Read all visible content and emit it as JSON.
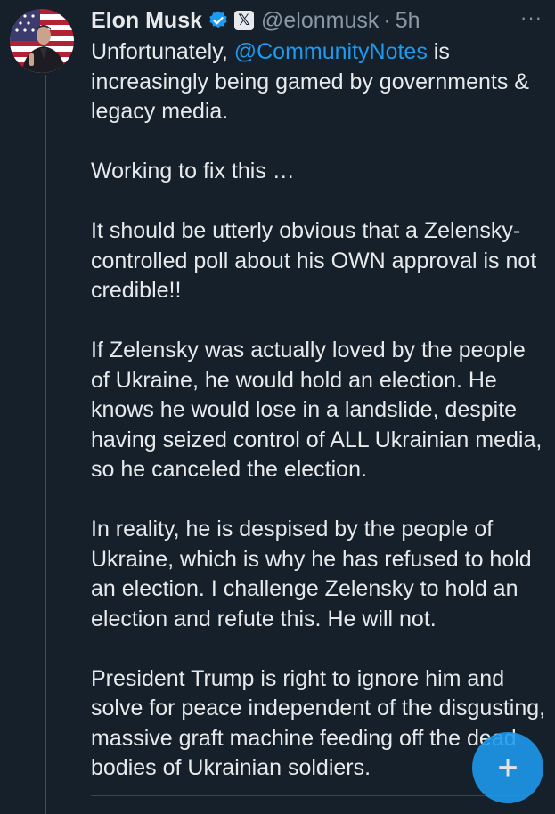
{
  "tweet": {
    "author_name": "Elon Musk",
    "handle": "@elonmusk",
    "separator": "·",
    "time": "5h",
    "x_badge": "𝕏",
    "more_glyph": "···",
    "mention": "@CommunityNotes",
    "paragraphs": [
      {
        "pre": "Unfortunately, ",
        "post": " is increasingly being gamed by governments & legacy media."
      },
      {
        "text": "Working to fix this …"
      },
      {
        "text": "It should be utterly obvious that a Zelensky-controlled poll about his OWN approval is not credible!!"
      },
      {
        "text": "If Zelensky was actually loved by the people of Ukraine, he would hold an election. He knows he would lose in a landslide, despite having seized control of ALL Ukrainian media, so he canceled the election."
      },
      {
        "text": "In reality, he is despised by the people of Ukraine, which is why he has refused to hold an election. I challenge Zelensky to hold an election and refute this. He will not."
      },
      {
        "text": "President Trump is right to ignore him and solve for peace independent of the disgusting, massive graft machine feeding off the dead bodies of Ukrainian soldiers."
      }
    ]
  },
  "fab": {
    "icon": "+"
  },
  "colors": {
    "background": "#15202b",
    "text": "#e7e9ea",
    "secondary": "#8b98a5",
    "accent": "#1d9bf0"
  },
  "icons": {
    "verified": "verified-badge-icon",
    "more": "more-options-icon",
    "compose": "plus-icon"
  }
}
